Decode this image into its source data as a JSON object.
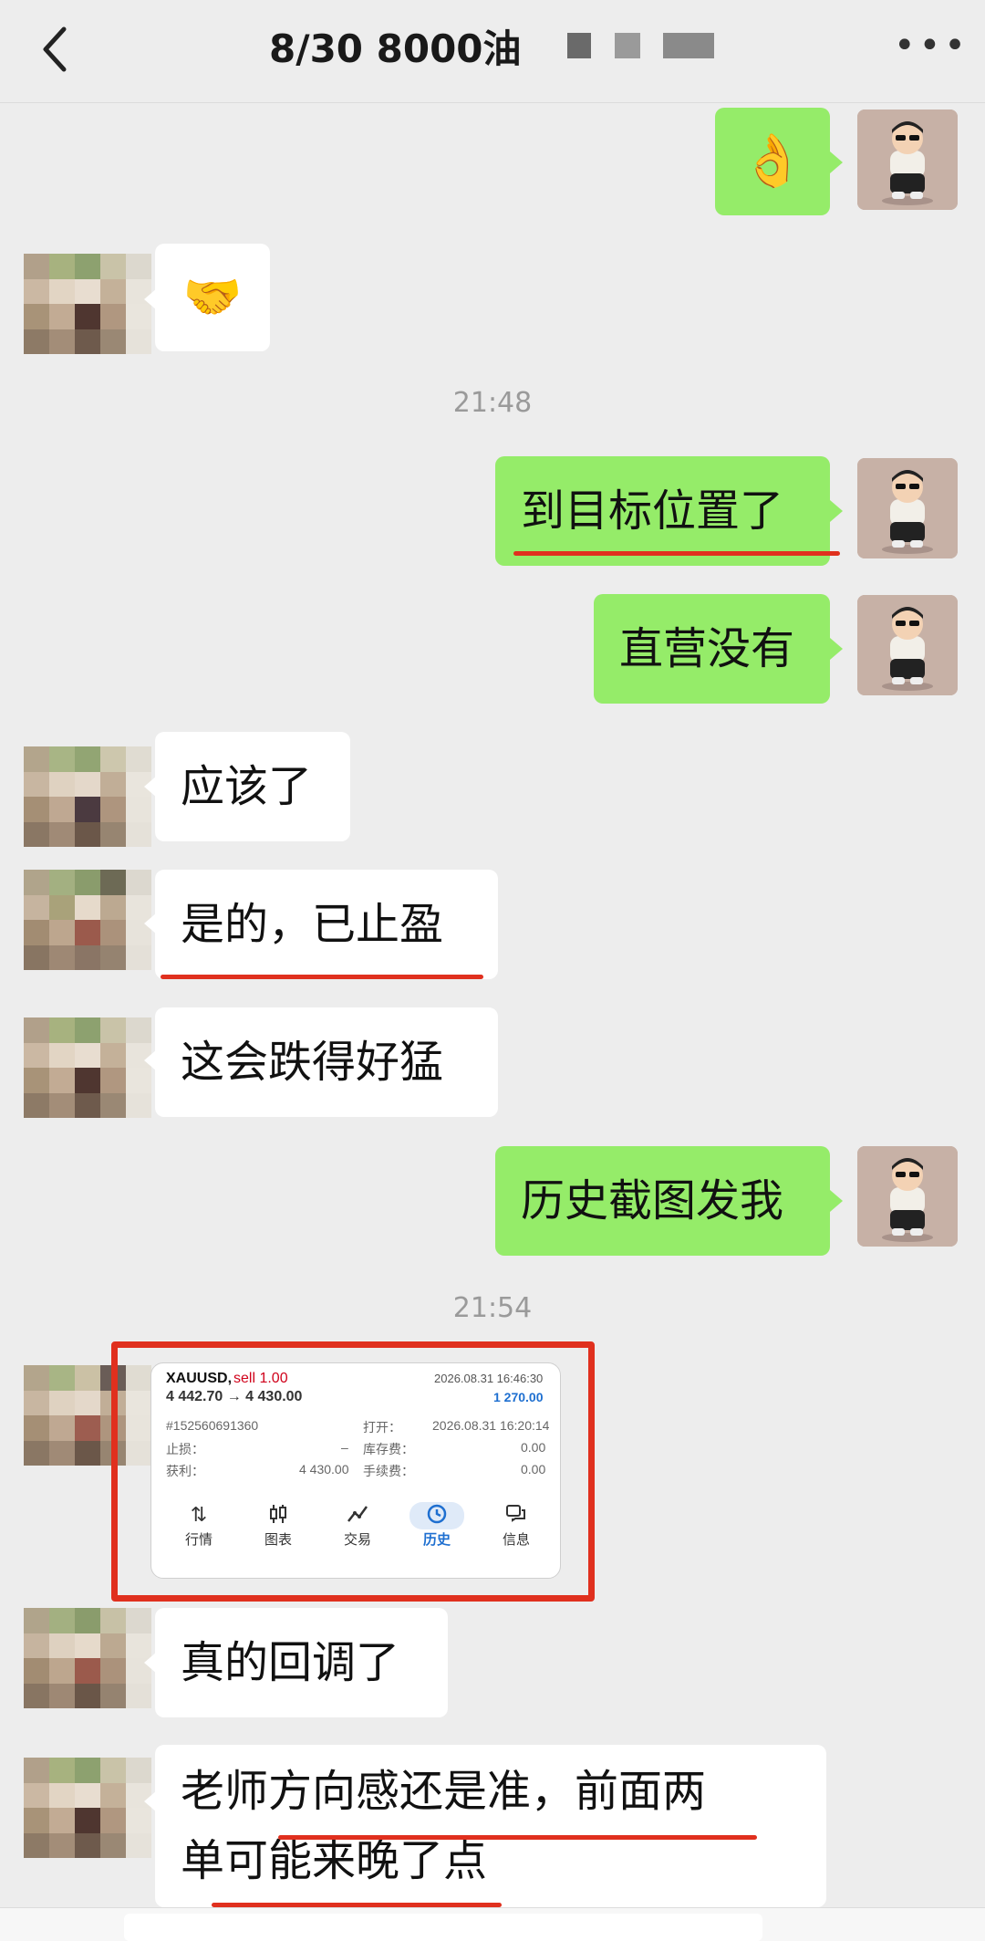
{
  "header": {
    "title": "8/30  8000油",
    "back_icon": "chevron-left-icon",
    "more_icon": "more-horizontal-icon"
  },
  "messages": {
    "m1_emoji": "👌",
    "m2_emoji": "🤝",
    "time1": "21:48",
    "m3": "到目标位置了",
    "m4": "直营没有",
    "m5": "应该了",
    "m6": "是的，已止盈",
    "m7": "这会跌得好猛",
    "m8": "历史截图发我",
    "time2": "21:54",
    "m10": "真的回调了",
    "m11_line1": "老师方向感还是准，前面两",
    "m11_line2": "单可能来晚了点"
  },
  "trade_card": {
    "symbol": "XAUUSD,",
    "side": "sell 1.00",
    "close_time": "2026.08.31 16:46:30",
    "prices": "4 442.70 → 4 430.00",
    "profit": "1 270.00",
    "order_id": "#152560691360",
    "open_label": "打开：",
    "open_time": "2026.08.31 16:20:14",
    "sl_label": "止损：",
    "sl_value": "–",
    "swap_label": "库存费：",
    "swap_value": "0.00",
    "tp_label": "获利：",
    "tp_value": "4 430.00",
    "fee_label": "手续费：",
    "fee_value": "0.00",
    "nav": [
      "行情",
      "图表",
      "交易",
      "历史",
      "信息"
    ]
  },
  "colors": {
    "my_bubble": "#95ec69",
    "their_bubble": "#ffffff",
    "background": "#ededed",
    "annotation_red": "#e0301e",
    "sell_red": "#d0021b",
    "profit_blue": "#1e6fd0"
  }
}
